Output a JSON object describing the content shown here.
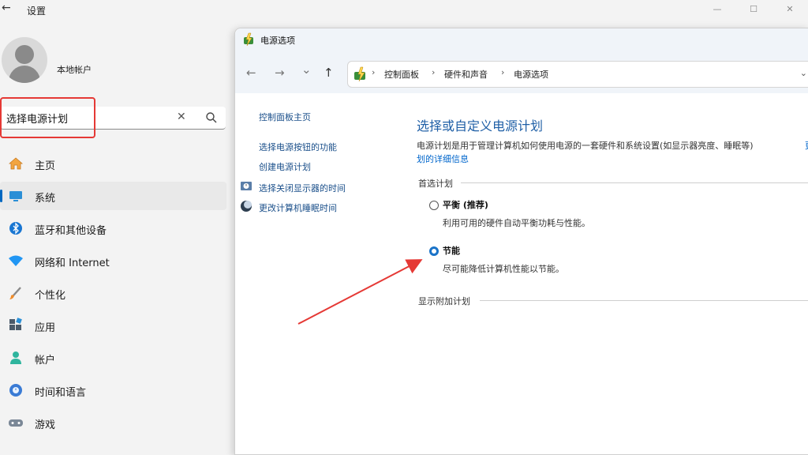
{
  "settings": {
    "back_glyph": "←",
    "title": "设置",
    "window_controls": {
      "minimize": "—",
      "maximize": "☐",
      "close": "✕"
    },
    "account_name": "本地帐户",
    "search": {
      "value": "选择电源计划",
      "clear_glyph": "✕"
    },
    "nav_items": [
      {
        "label": "主页",
        "icon": "home-icon",
        "selected": false
      },
      {
        "label": "系统",
        "icon": "monitor-icon",
        "selected": true
      },
      {
        "label": "蓝牙和其他设备",
        "icon": "bluetooth-icon",
        "selected": false
      },
      {
        "label": "网络和 Internet",
        "icon": "wifi-icon",
        "selected": false
      },
      {
        "label": "个性化",
        "icon": "brush-icon",
        "selected": false
      },
      {
        "label": "应用",
        "icon": "apps-icon",
        "selected": false
      },
      {
        "label": "帐户",
        "icon": "person-icon",
        "selected": false
      },
      {
        "label": "时间和语言",
        "icon": "globe-clock-icon",
        "selected": false
      },
      {
        "label": "游戏",
        "icon": "gamepad-icon",
        "selected": false
      }
    ]
  },
  "power_window": {
    "title": "电源选项",
    "nav": {
      "back": "←",
      "forward": "→",
      "recent": "⌄",
      "up": "↑"
    },
    "breadcrumb": {
      "sep": "›",
      "items": [
        "控制面板",
        "硬件和声音",
        "电源选项"
      ],
      "dropdown": "⌄"
    },
    "left_links": [
      {
        "label": "控制面板主页",
        "icon": null
      },
      {
        "label": "选择电源按钮的功能",
        "icon": null
      },
      {
        "label": "创建电源计划",
        "icon": null
      },
      {
        "label": "选择关闭显示器的时间",
        "icon": "clock-shield-icon"
      },
      {
        "label": "更改计算机睡眠时间",
        "icon": "moon-icon"
      }
    ],
    "heading": "选择或自定义电源计划",
    "description": "电源计划是用于管理计算机如何使用电源的一套硬件和系统设置(如显示器亮度、睡眠等)",
    "description_link": "更",
    "more_info_link": "划的详细信息",
    "preferred_group": "首选计划",
    "plans": [
      {
        "name": "平衡 (推荐)",
        "desc": "利用可用的硬件自动平衡功耗与性能。",
        "checked": false
      },
      {
        "name": "节能",
        "desc": "尽可能降低计算机性能以节能。",
        "checked": true
      }
    ],
    "additional_group": "显示附加计划"
  },
  "colors": {
    "accent": "#0067c0",
    "annotation_red": "#e53935",
    "link": "#1a4f8a",
    "heading_blue": "#1f5fa6"
  }
}
